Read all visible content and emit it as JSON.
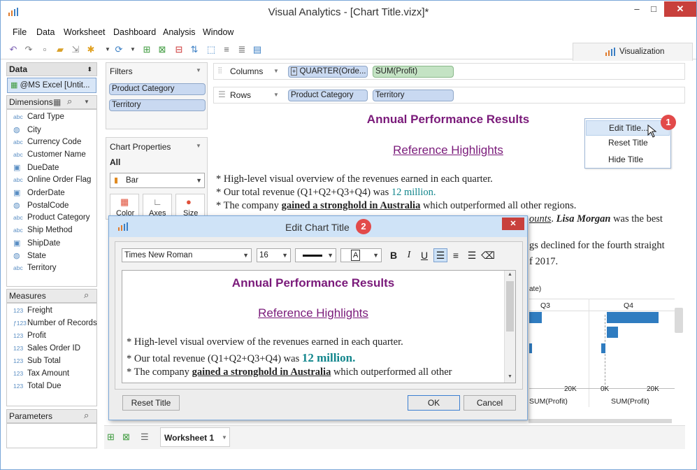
{
  "window": {
    "title": "Visual Analytics - [Chart Title.vizx]*",
    "minimize": "–",
    "maximize": "□",
    "close": "✕"
  },
  "menu": [
    "File",
    "Data",
    "Worksheet",
    "Dashboard",
    "Analysis",
    "Window"
  ],
  "visualization_tab": "Visualization",
  "data_pane": {
    "header": "Data",
    "source": "@MS Excel [Untit...",
    "dimensions_label": "Dimensions",
    "dimensions": [
      {
        "type": "abc",
        "name": "Card Type"
      },
      {
        "type": "globe",
        "name": "City"
      },
      {
        "type": "abc",
        "name": "Currency Code"
      },
      {
        "type": "abc",
        "name": "Customer Name"
      },
      {
        "type": "date",
        "name": "DueDate"
      },
      {
        "type": "abc",
        "name": "Online Order Flag"
      },
      {
        "type": "date",
        "name": "OrderDate"
      },
      {
        "type": "globe",
        "name": "PostalCode"
      },
      {
        "type": "abc",
        "name": "Product Category"
      },
      {
        "type": "abc",
        "name": "Ship Method"
      },
      {
        "type": "date",
        "name": "ShipDate"
      },
      {
        "type": "globe",
        "name": "State"
      },
      {
        "type": "abc",
        "name": "Territory"
      }
    ],
    "measures_label": "Measures",
    "measures": [
      {
        "type": "123",
        "name": "Freight"
      },
      {
        "type": "fx123",
        "name": "Number of Records"
      },
      {
        "type": "123",
        "name": "Profit"
      },
      {
        "type": "123",
        "name": "Sales Order ID"
      },
      {
        "type": "123",
        "name": "Sub Total"
      },
      {
        "type": "123",
        "name": "Tax Amount"
      },
      {
        "type": "123",
        "name": "Total Due"
      }
    ],
    "parameters_label": "Parameters"
  },
  "filters": {
    "header": "Filters",
    "items": [
      "Product Category",
      "Territory"
    ]
  },
  "chart_properties": {
    "header": "Chart Properties",
    "all_label": "All",
    "mark_type": "Bar",
    "buttons": [
      "Color",
      "Axes",
      "Size"
    ]
  },
  "shelves": {
    "columns_label": "Columns",
    "rows_label": "Rows",
    "columns": [
      "QUARTER(Orde...",
      "SUM(Profit)"
    ],
    "rows": [
      "Product Category",
      "Territory"
    ]
  },
  "chart": {
    "title": "Annual Performance Results",
    "subtitle": "Reference Highlights",
    "line1": "* High-level visual overview of the revenues earned in each quarter.",
    "line2_pre": "* Our total revenue (Q1+Q2+Q3+Q4) was ",
    "line2_value": "12 million.",
    "line3_pre": "* The company ",
    "line3_bold": "gained a stronghold in Australia",
    "line3_post": " which outperformed all other regions.",
    "line4_fragment": "ounts",
    "line4_name": "Lisa Morgan",
    "line4_post": " was the best",
    "line5_fragment": "gs declined for the fourth straight",
    "line6_fragment": "f 2017.",
    "axis_partial": "ate)",
    "col_q3": "Q3",
    "col_q4": "Q4",
    "tick_20k_a": "20K",
    "tick_0k": "0K",
    "tick_20k_b": "20K",
    "axis_label_a": "SUM(Profit)",
    "axis_label_b": "SUM(Profit)",
    "bar_color": "#2f7cc0"
  },
  "context_menu": {
    "items": [
      "Edit Title...",
      "Reset Title",
      "Hide Title"
    ],
    "badge": "1"
  },
  "dialog": {
    "title": "Edit Chart Title",
    "badge": "2",
    "close": "✕",
    "font": "Times New Roman",
    "size": "16",
    "bold": "B",
    "italic": "I",
    "underline": "U",
    "preview_title": "Annual Performance Results",
    "preview_subtitle": "Reference Highlights",
    "p1": "* High-level visual overview of the revenues earned in each quarter.",
    "p2_pre": "* Our total revenue (Q1+Q2+Q3+Q4) was ",
    "p2_value": "12 million.",
    "p3_pre": "* The company ",
    "p3_bold": "gained a stronghold in Australia",
    "p3_post": " which outperformed all other",
    "reset_button": "Reset Title",
    "ok_button": "OK",
    "cancel_button": "Cancel"
  },
  "bottom": {
    "sheet_tab": "Worksheet 1"
  },
  "colors": {
    "title_purple": "#7a1a7a",
    "teal": "#12868c",
    "accent": "#3875c4"
  }
}
